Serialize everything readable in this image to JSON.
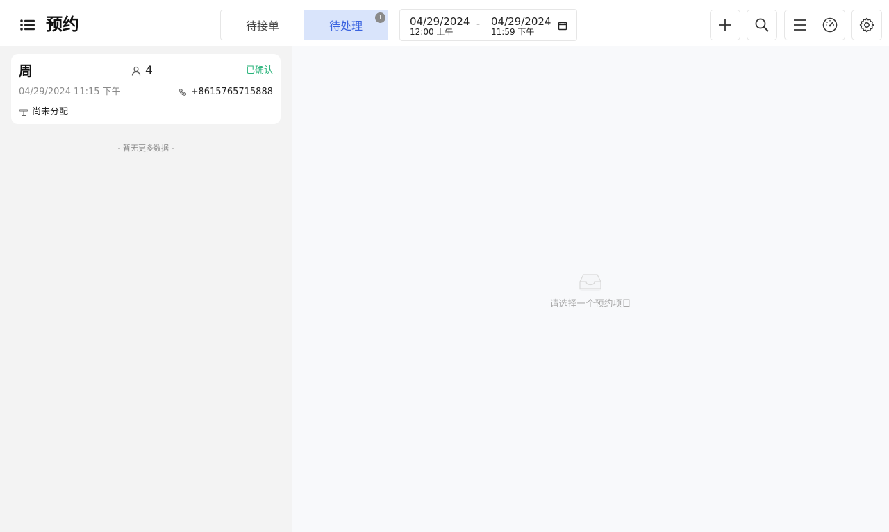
{
  "header": {
    "title": "预约",
    "tabs": [
      {
        "label": "待接单",
        "active": false
      },
      {
        "label": "待处理",
        "active": true,
        "badge": "1"
      }
    ],
    "date_range": {
      "start_date": "04/29/2024",
      "start_time": "12:00 上午",
      "separator": "-",
      "end_date": "04/29/2024",
      "end_time": "11:59 下午"
    },
    "icons": [
      "add-icon",
      "search-icon",
      "list-icon",
      "dashboard-icon",
      "settings-icon"
    ]
  },
  "reservations": [
    {
      "name": "周",
      "guests": "4",
      "status": "已确认",
      "datetime": "04/29/2024 11:15 下午",
      "phone": "+8615765715888",
      "table": "尚未分配"
    }
  ],
  "list_footer": "- 暂无更多数据 -",
  "empty_state": {
    "text": "请选择一个预约项目"
  },
  "colors": {
    "accent": "#3a63e0",
    "tab_active_bg": "#d9e4fb",
    "confirmed": "#28b37a"
  }
}
